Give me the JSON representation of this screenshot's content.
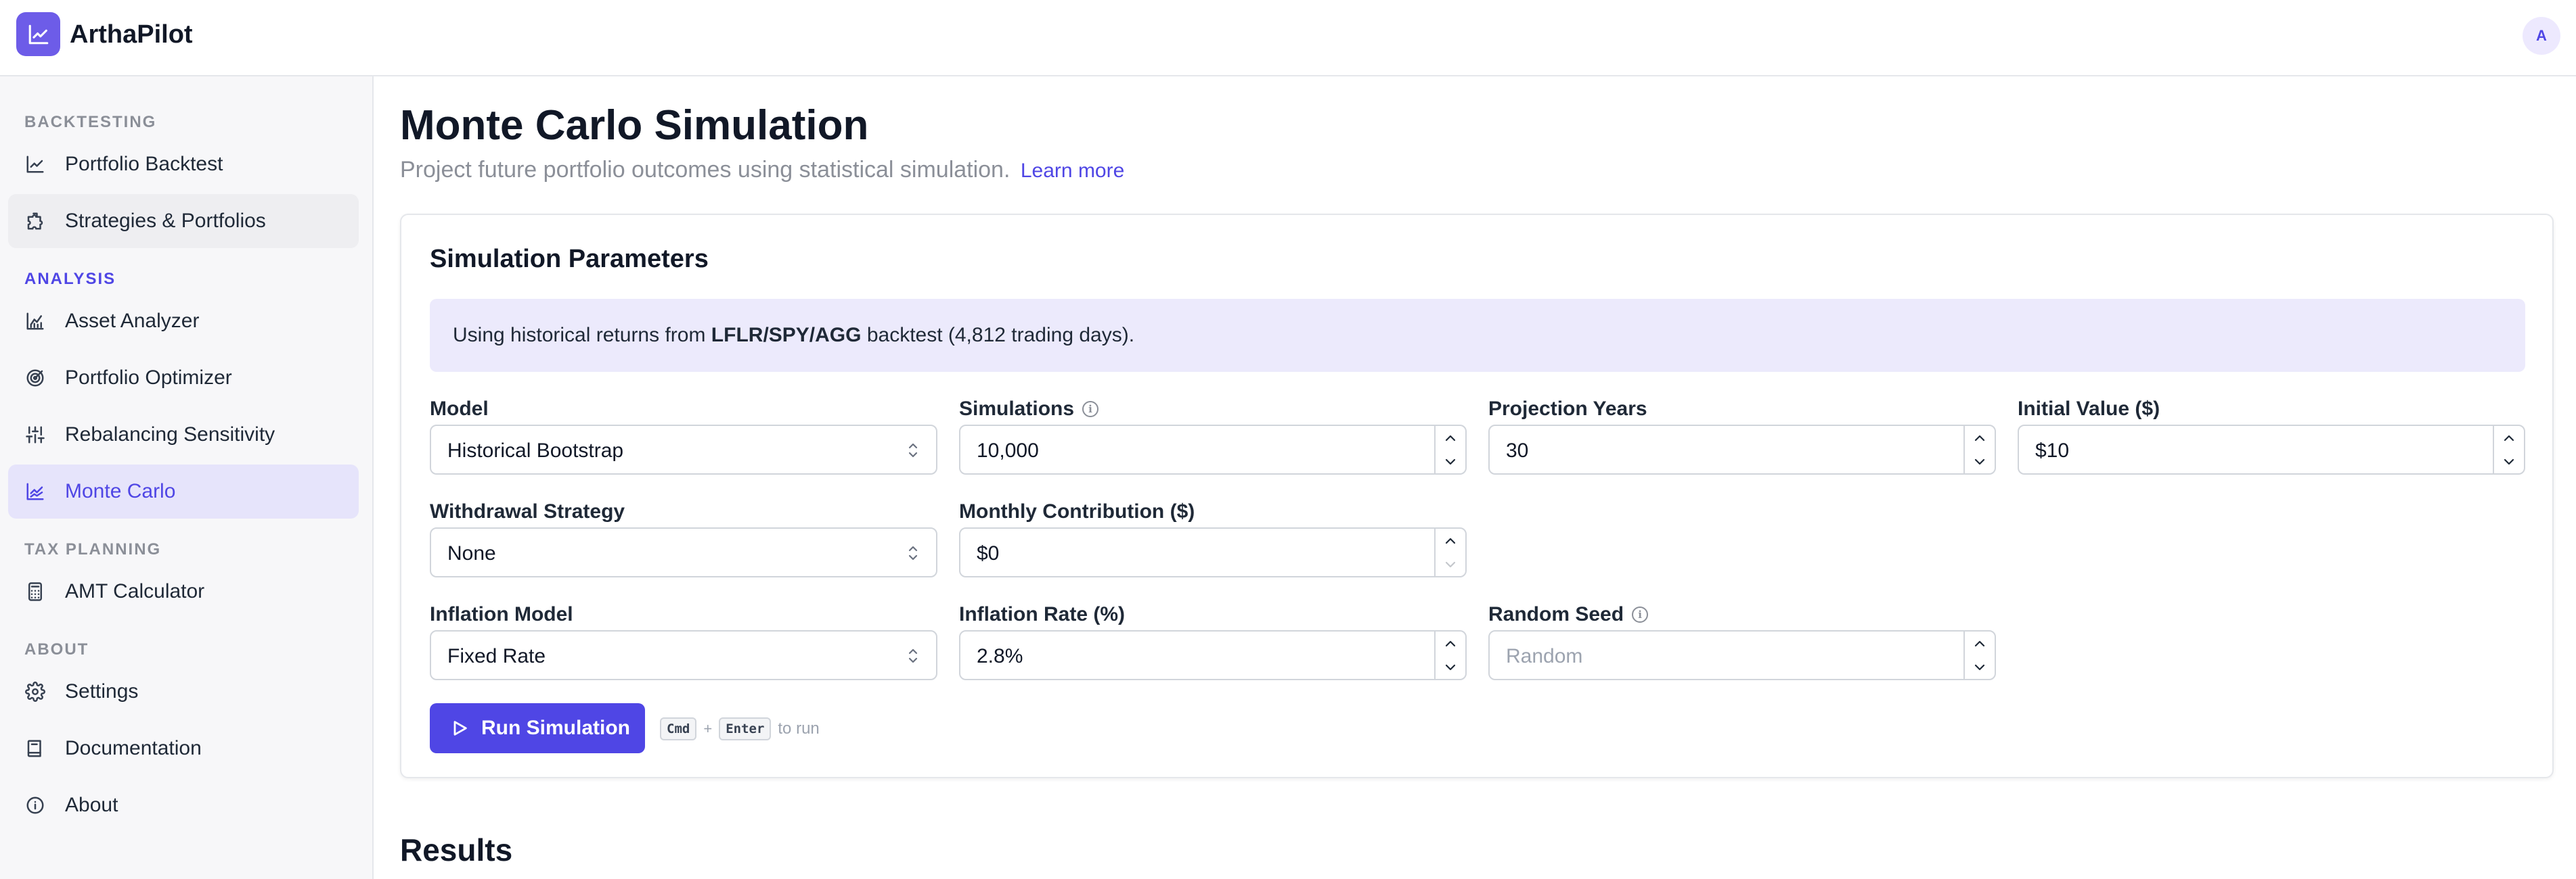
{
  "app": {
    "title": "ArthaPilot",
    "avatar_initial": "A",
    "brand_color": "#6d5ce8",
    "accent_color": "#4f46e5"
  },
  "sidebar": {
    "sections": [
      {
        "label": "BACKTESTING"
      },
      {
        "label": "ANALYSIS"
      },
      {
        "label": "TAX PLANNING"
      },
      {
        "label": "ABOUT"
      }
    ],
    "items": [
      {
        "label": "Portfolio Backtest",
        "icon": "chart-line-icon"
      },
      {
        "label": "Strategies & Portfolios",
        "icon": "puzzle-icon"
      },
      {
        "label": "Asset Analyzer",
        "icon": "chart-line-up-icon"
      },
      {
        "label": "Portfolio Optimizer",
        "icon": "target-icon"
      },
      {
        "label": "Rebalancing Sensitivity",
        "icon": "sliders-icon"
      },
      {
        "label": "Monte Carlo",
        "icon": "chart-area-icon",
        "active": true
      },
      {
        "label": "AMT Calculator",
        "icon": "calculator-icon"
      },
      {
        "label": "Settings",
        "icon": "gear-icon"
      },
      {
        "label": "Documentation",
        "icon": "book-icon"
      },
      {
        "label": "About",
        "icon": "info-icon"
      }
    ]
  },
  "main": {
    "title": "Monte Carlo Simulation",
    "subtitle": "Project future portfolio outcomes using statistical simulation.",
    "learn_more": "Learn more",
    "results_title": "Results"
  },
  "params": {
    "title": "Simulation Parameters",
    "banner": {
      "prefix": "Using historical returns from",
      "tickers": "LFLR/SPY/AGG",
      "suffix": "backtest (4,812 trading days)."
    },
    "model": {
      "label": "Model",
      "value": "Historical Bootstrap"
    },
    "simulations": {
      "label": "Simulations",
      "value": "10,000"
    },
    "projection_years": {
      "label": "Projection Years",
      "value": "30"
    },
    "initial_value": {
      "label": "Initial Value ($)",
      "value": "$10"
    },
    "withdrawal_strategy": {
      "label": "Withdrawal Strategy",
      "value": "None"
    },
    "monthly_contribution": {
      "label": "Monthly Contribution ($)",
      "value": "$0"
    },
    "inflation_model": {
      "label": "Inflation Model",
      "value": "Fixed Rate"
    },
    "inflation_rate": {
      "label": "Inflation Rate (%)",
      "value": "2.8%"
    },
    "random_seed": {
      "label": "Random Seed",
      "placeholder": "Random"
    },
    "run_button": "Run Simulation",
    "shortcut": {
      "key1": "Cmd",
      "plus": "+",
      "key2": "Enter",
      "tail": "to run"
    }
  }
}
